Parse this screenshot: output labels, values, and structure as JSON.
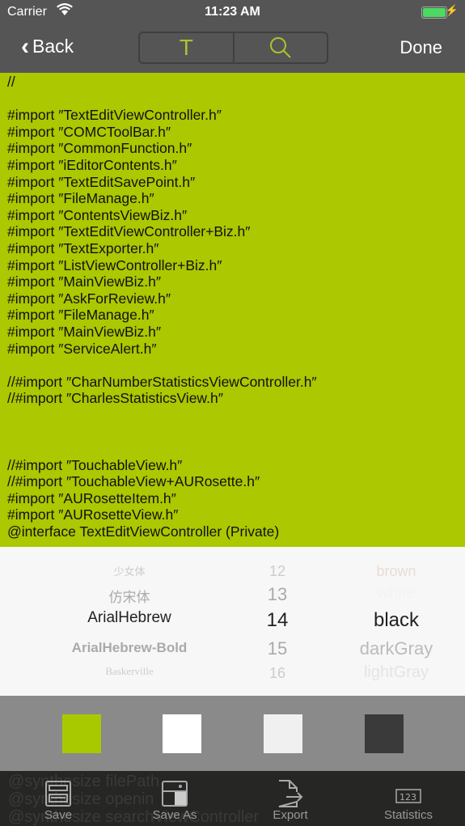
{
  "status": {
    "carrier": "Carrier",
    "time": "11:23 AM"
  },
  "nav": {
    "back": "Back",
    "done": "Done",
    "seg_text_icon": "T",
    "seg_search_icon": "search-icon"
  },
  "code_lines": [
    "//",
    "",
    "#import ″TextEditViewController.h″",
    "#import ″COMCToolBar.h″",
    "#import ″CommonFunction.h″",
    "#import ″iEditorContents.h″",
    "#import ″TextEditSavePoint.h″",
    "#import ″FileManage.h″",
    "#import ″ContentsViewBiz.h″",
    "#import ″TextEditViewController+Biz.h″",
    "#import ″TextExporter.h″",
    "#import ″ListViewController+Biz.h″",
    "#import ″MainViewBiz.h″",
    "#import ″AskForReview.h″",
    "#import ″FileManage.h″",
    "#import ″MainViewBiz.h″",
    "#import ″ServiceAlert.h″",
    "",
    "//#import ″CharNumberStatisticsViewController.h″",
    "//#import ″CharlesStatisticsView.h″",
    "",
    "",
    "",
    "//#import ″TouchableView.h″",
    "//#import ″TouchableView+AURosette.h″",
    "#import ″AURosetteItem.h″",
    "#import ″AURosetteView.h″",
    "@interface TextEditViewController (Private)"
  ],
  "picker": {
    "fonts": [
      "少女体",
      "仿宋体",
      "ArialHebrew",
      "ArialHebrew-Bold",
      "Baskerville"
    ],
    "sizes": [
      "12",
      "13",
      "14",
      "15",
      "16"
    ],
    "colors": [
      "brown",
      "white",
      "black",
      "darkGray",
      "lightGray"
    ],
    "selected": {
      "font": "ArialHebrew",
      "size": "14",
      "color": "black"
    }
  },
  "swatches": [
    "#a8c800",
    "#ffffff",
    "#f0f0f0",
    "#3a3a3a"
  ],
  "background_code": [
    "@synthesize filePath",
    "@synthesize openin",
    "@synthesize searchViewController"
  ],
  "toolbar": {
    "save": "Save",
    "save_as": "Save As",
    "export": "Export",
    "statistics": "Statistics"
  }
}
